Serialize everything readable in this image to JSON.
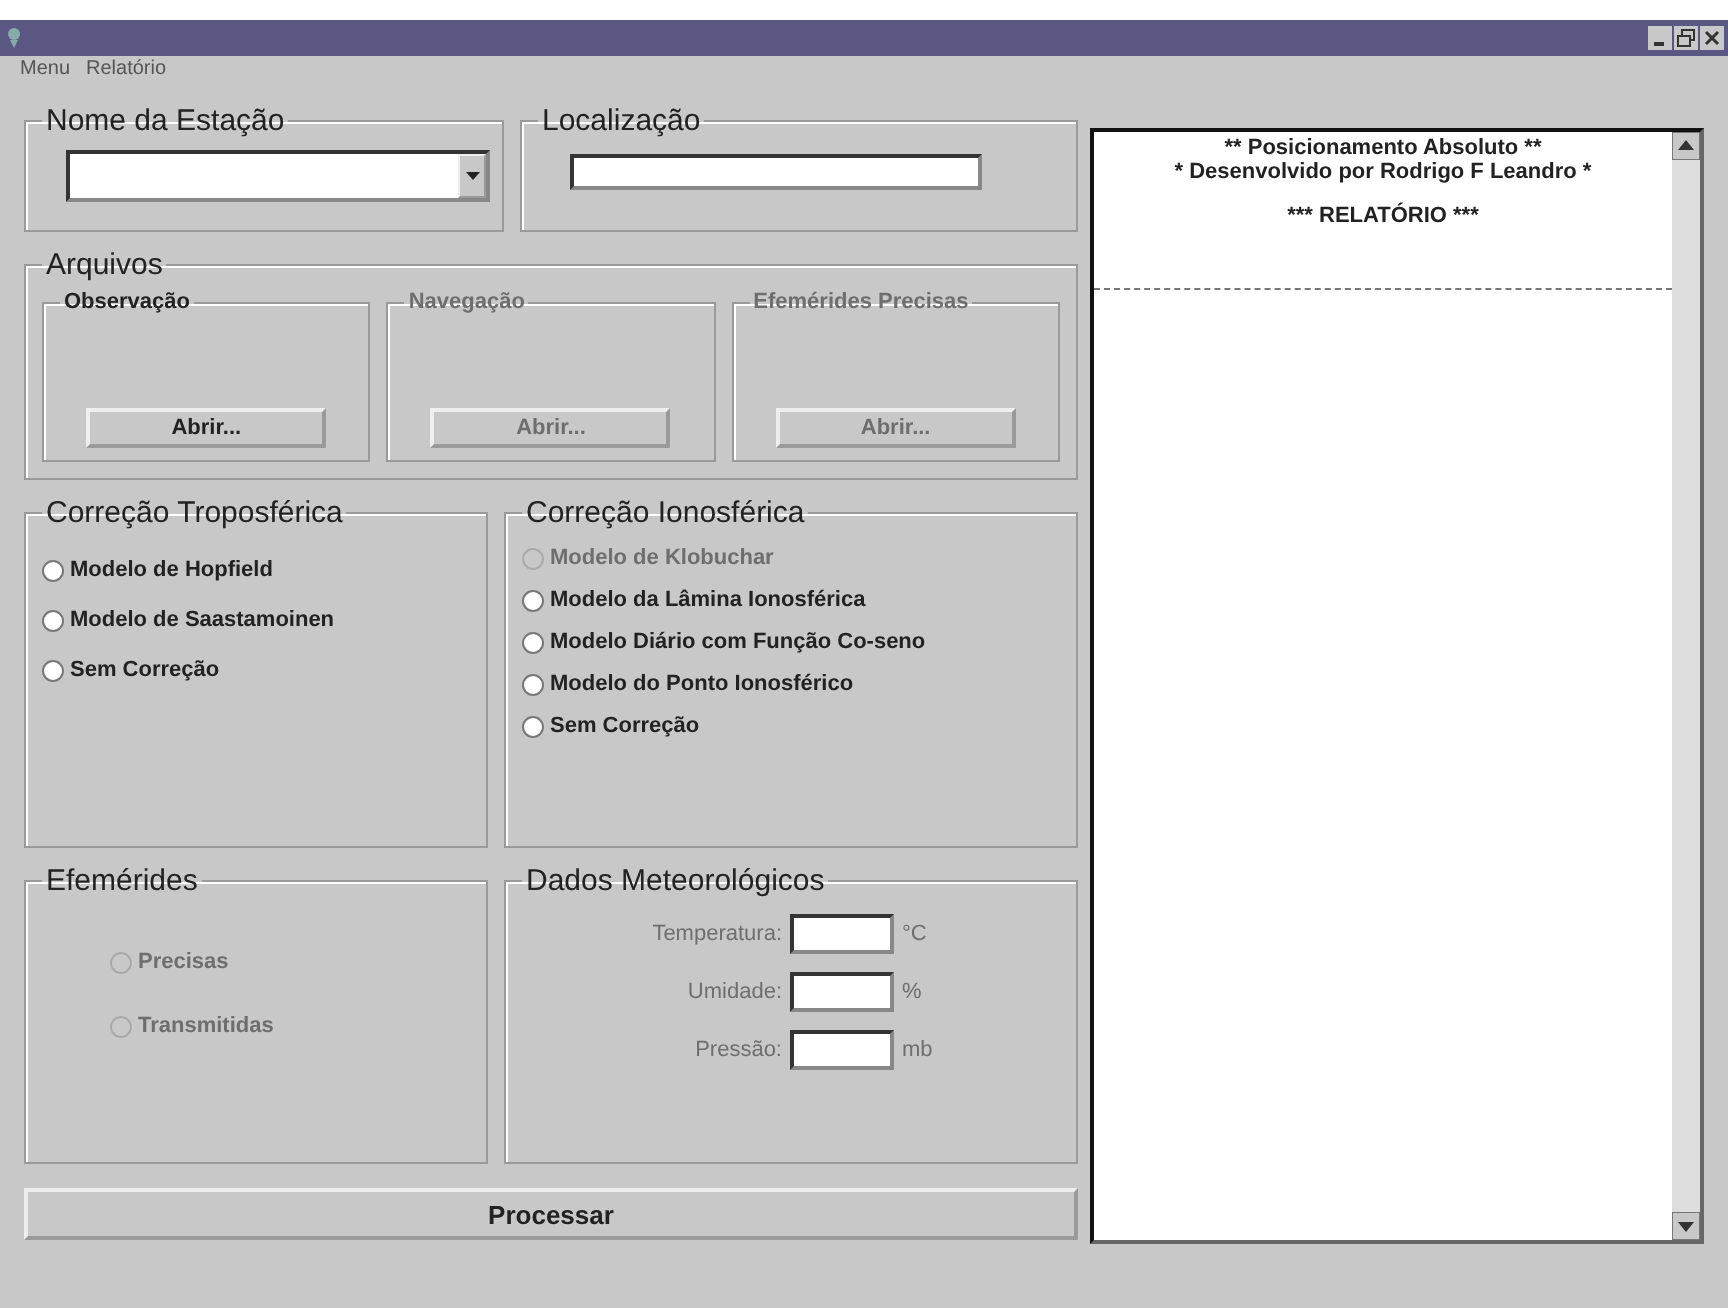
{
  "menu": [
    {
      "label": "Menu"
    },
    {
      "label": "Relatório"
    }
  ],
  "station": {
    "label": "Nome da Estação"
  },
  "location": {
    "label": "Localização"
  },
  "files": {
    "label": "Arquivos",
    "groups": [
      {
        "label": "Observação",
        "button": "Abrir...",
        "disabled": false
      },
      {
        "label": "Navegação",
        "button": "Abrir...",
        "disabled": true
      },
      {
        "label": "Efemérides Precisas",
        "button": "Abrir...",
        "disabled": true
      }
    ]
  },
  "tropo": {
    "label": "Correção Troposférica",
    "options": [
      {
        "label": "Modelo de Hopfield",
        "selected": false,
        "disabled": false
      },
      {
        "label": "Modelo de Saastamoinen",
        "selected": false,
        "disabled": false
      },
      {
        "label": "Sem Correção",
        "selected": false,
        "disabled": false
      }
    ]
  },
  "iono": {
    "label": "Correção Ionosférica",
    "options": [
      {
        "label": "Modelo de Klobuchar",
        "selected": false,
        "disabled": true
      },
      {
        "label": "Modelo da Lâmina Ionosférica",
        "selected": false,
        "disabled": false
      },
      {
        "label": "Modelo Diário com Função Co-seno",
        "selected": false,
        "disabled": false
      },
      {
        "label": "Modelo do Ponto Ionosférico",
        "selected": false,
        "disabled": false
      },
      {
        "label": "Sem Correção",
        "selected": false,
        "disabled": false
      }
    ]
  },
  "ephemerides": {
    "label": "Efemérides",
    "options": [
      {
        "label": "Precisas",
        "selected": false,
        "disabled": true
      },
      {
        "label": "Transmitidas",
        "selected": false,
        "disabled": true
      }
    ]
  },
  "meteo": {
    "label": "Dados Meteorológicos",
    "fields": [
      {
        "label": "Temperatura:",
        "unit": "°C",
        "disabled": true
      },
      {
        "label": "Umidade:",
        "unit": "%",
        "disabled": true
      },
      {
        "label": "Pressão:",
        "unit": "mb",
        "disabled": true
      }
    ]
  },
  "process_button": "Processar",
  "report": {
    "header": [
      "** Posicionamento Absoluto **",
      "* Desenvolvido por Rodrigo F Leandro *"
    ],
    "title": "*** RELATÓRIO ***"
  }
}
